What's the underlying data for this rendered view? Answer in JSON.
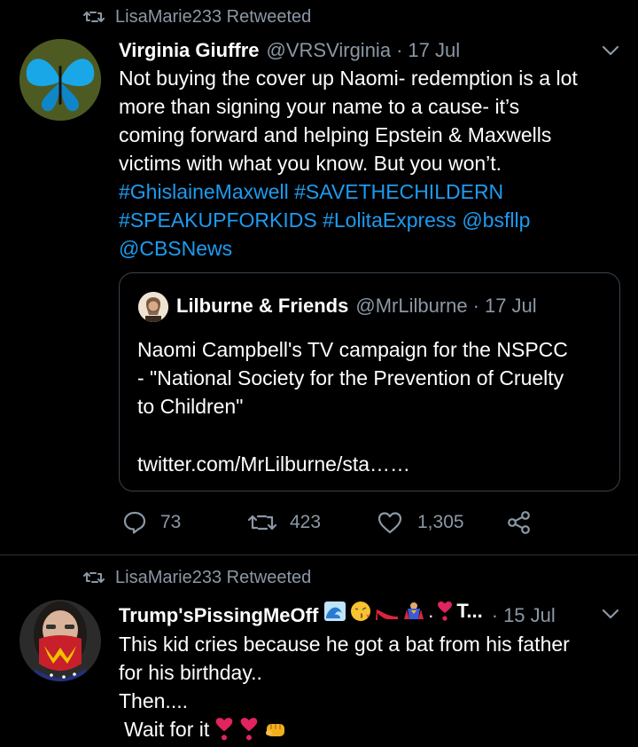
{
  "tweet1": {
    "retweeted_by": "LisaMarie233 Retweeted",
    "display_name": "Virginia Giuffre",
    "handle": "@VRSVirginia",
    "separator": "·",
    "date": "17 Jul",
    "text_lines": [
      "Not buying the cover up Naomi- redemption is a lot",
      "more than signing your name to a cause- it’s",
      "coming forward and helping Epstein & Maxwells",
      "victims with what you know. But you won’t."
    ],
    "hashtag_line1": [
      "#GhislaineMaxwell",
      "#SAVETHECHILDERN"
    ],
    "hashtag_line2": [
      "#SPEAKUPFORKIDS",
      "#LolitaExpress",
      "@bsfllp"
    ],
    "mention_line3": "@CBSNews",
    "quote": {
      "display_name": "Lilburne & Friends",
      "handle": "@MrLilburne",
      "separator": "·",
      "date": "17 Jul",
      "text_lines": [
        "Naomi Campbell's TV campaign for the NSPCC",
        "- \"National Society for the Prevention of Cruelty",
        "to Children\""
      ],
      "link": "twitter.com/MrLilburne/sta……"
    },
    "replies": "73",
    "retweets": "423",
    "likes": "1,305"
  },
  "tweet2": {
    "retweeted_by": "LisaMarie233 Retweeted",
    "display_name": "Trump'sPissingMeOff",
    "name_suffix": "T...",
    "separator": "·",
    "date": "15 Jul",
    "text_lines": [
      "This kid cries because he got a bat from his father",
      "for his birthday..",
      "Then....",
      "Wait for it"
    ]
  },
  "colors": {
    "background": "#000000",
    "text": "#ffffff",
    "muted": "#8b98a5",
    "link": "#1d9bf0",
    "border": "#38444d"
  }
}
